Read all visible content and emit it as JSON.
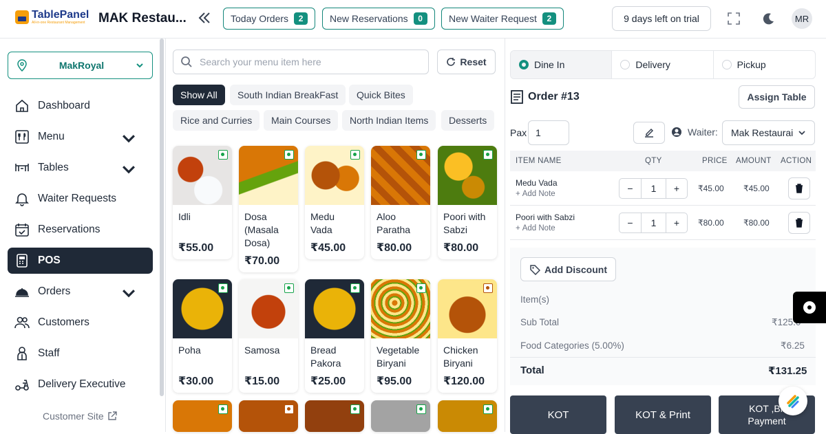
{
  "header": {
    "logo_text": "TablePanel",
    "logo_tagline": "All-in-one Restaurant Management",
    "restaurant_name": "MAK Restau...",
    "today_orders_label": "Today Orders",
    "today_orders_count": "2",
    "new_reservations_label": "New Reservations",
    "new_reservations_count": "0",
    "waiter_request_label": "New Waiter Request",
    "waiter_request_count": "2",
    "trial_label": "9 days left on trial",
    "avatar_initials": "MR"
  },
  "sidebar": {
    "branch": "MakRoyal",
    "items": [
      {
        "label": "Dashboard"
      },
      {
        "label": "Menu"
      },
      {
        "label": "Tables"
      },
      {
        "label": "Waiter Requests"
      },
      {
        "label": "Reservations"
      },
      {
        "label": "POS"
      },
      {
        "label": "Orders"
      },
      {
        "label": "Customers"
      },
      {
        "label": "Staff"
      },
      {
        "label": "Delivery Executive"
      }
    ],
    "customer_site": "Customer Site"
  },
  "menu": {
    "search_placeholder": "Search your menu item here",
    "reset_label": "Reset",
    "categories": [
      "Show All",
      "South Indian BreakFast",
      "Quick Bites",
      "Rice and Curries",
      "Main Courses",
      "North Indian Items",
      "Desserts"
    ],
    "items": [
      {
        "name": "Idli",
        "price": "₹55.00"
      },
      {
        "name": "Dosa (Masala Dosa)",
        "price": "₹70.00"
      },
      {
        "name": "Medu Vada",
        "price": "₹45.00"
      },
      {
        "name": "Aloo Paratha",
        "price": "₹80.00"
      },
      {
        "name": "Poori with Sabzi",
        "price": "₹80.00"
      },
      {
        "name": "Poha",
        "price": "₹30.00"
      },
      {
        "name": "Samosa",
        "price": "₹15.00"
      },
      {
        "name": "Bread Pakora",
        "price": "₹25.00"
      },
      {
        "name": "Vegetable Biryani",
        "price": "₹95.00"
      },
      {
        "name": "Chicken Biryani",
        "price": "₹120.00"
      }
    ]
  },
  "order": {
    "types": [
      "Dine In",
      "Delivery",
      "Pickup"
    ],
    "title": "Order #13",
    "assign_table": "Assign Table",
    "pax_label": "Pax",
    "pax_value": "1",
    "waiter_label": "Waiter:",
    "waiter_value": "Mak Restaurai",
    "columns": [
      "ITEM NAME",
      "QTY",
      "PRICE",
      "AMOUNT",
      "ACTION"
    ],
    "lines": [
      {
        "name": "Medu Vada",
        "note": "Add Note",
        "qty": "1",
        "price": "₹45.00",
        "amount": "₹45.00"
      },
      {
        "name": "Poori with Sabzi",
        "note": "Add Note",
        "qty": "1",
        "price": "₹80.00",
        "amount": "₹80.00"
      }
    ],
    "add_discount": "Add Discount",
    "items_label": "Item(s)",
    "subtotal_label": "Sub Total",
    "subtotal_value": "₹125.0",
    "tax_label": "Food Categories (5.00%)",
    "tax_value": "₹6.25",
    "total_label": "Total",
    "total_value": "₹131.25",
    "kot": "KOT",
    "kot_print": "KOT & Print",
    "kot_bill": "KOT ,Bil Payment"
  }
}
